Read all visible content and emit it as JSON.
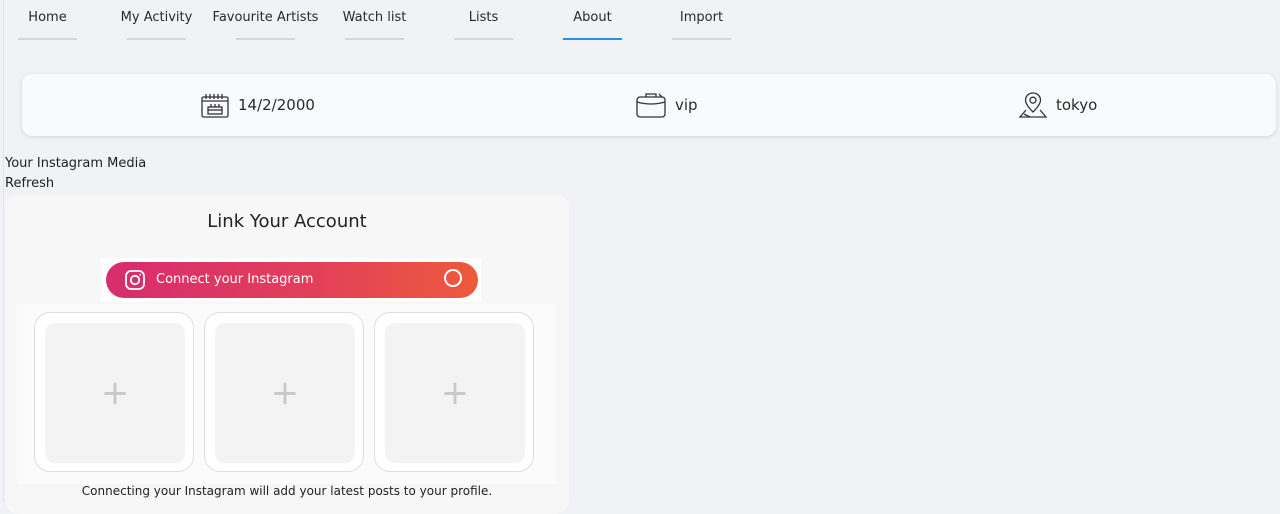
{
  "tabs": [
    {
      "label": "Home",
      "active": false
    },
    {
      "label": "My Activity",
      "active": false
    },
    {
      "label": "Favourite Artists",
      "active": false
    },
    {
      "label": "Watch list",
      "active": false
    },
    {
      "label": "Lists",
      "active": false
    },
    {
      "label": "About",
      "active": true
    },
    {
      "label": "Import",
      "active": false
    }
  ],
  "profile_info": {
    "birthday": "14/2/2000",
    "membership": "vip",
    "location": "tokyo"
  },
  "instagram": {
    "section_title": "Your Instagram Media",
    "refresh_label": "Refresh",
    "panel_title": "Link Your Account",
    "connect_label": "Connect your Instagram",
    "slot_glyph": "+",
    "caption": "Connecting your Instagram will add your latest posts to your profile."
  },
  "colors": {
    "active_tab": "#2d8fe0",
    "instagram_gradient_start": "#d72d6e",
    "instagram_gradient_end": "#ed5a3c"
  },
  "icons": {
    "birthday": "birthday-cake-icon",
    "membership": "briefcase-icon",
    "location": "map-pin-icon",
    "instagram": "instagram-icon",
    "add": "plus-icon"
  }
}
